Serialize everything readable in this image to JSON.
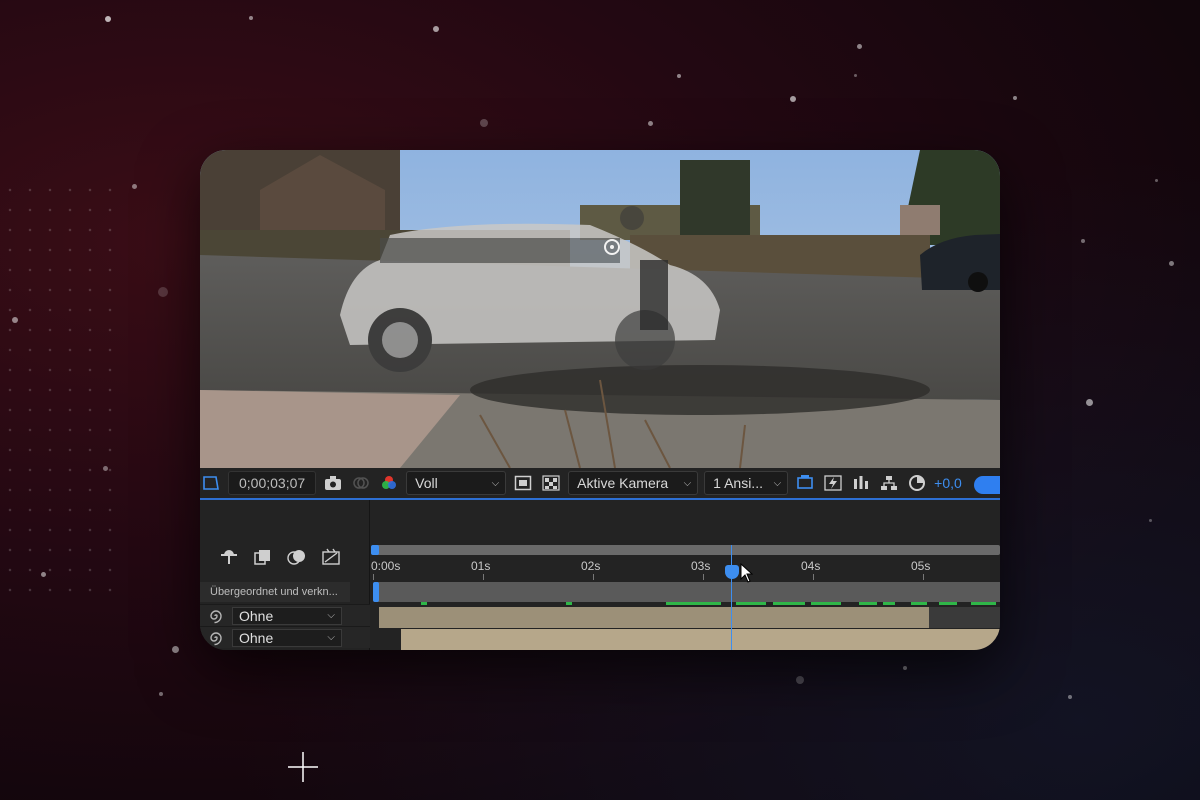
{
  "toolbar": {
    "timecode": "0;00;03;07",
    "resolution": "Voll",
    "camera": "Aktive Kamera",
    "views": "1 Ansi...",
    "exposure": "+0,0"
  },
  "timeline": {
    "column_header": "Übergeordnet und verkn...",
    "parent_rows": [
      {
        "value": "Ohne"
      },
      {
        "value": "Ohne"
      }
    ],
    "ruler": [
      "0:00s",
      "01s",
      "02s",
      "03s",
      "04s",
      "05s"
    ],
    "playhead_seconds": 3.25
  },
  "colors": {
    "accent": "#3d8ef0",
    "layer_1": "#9c9078",
    "layer_2": "#b6a78a",
    "keyframe_green": "#2fb648"
  },
  "icons": [
    "region-icon",
    "snapshot-icon",
    "show-snapshot-icon",
    "color-channel-icon",
    "roi-icon",
    "transparency-grid-icon",
    "fast-preview-icon",
    "flowchart-icon",
    "reset-exposure-icon",
    "composition-mini-flowchart-icon",
    "frame-blending-icon",
    "motion-blur-icon",
    "graph-editor-icon",
    "parent-pickwhip-icon"
  ]
}
